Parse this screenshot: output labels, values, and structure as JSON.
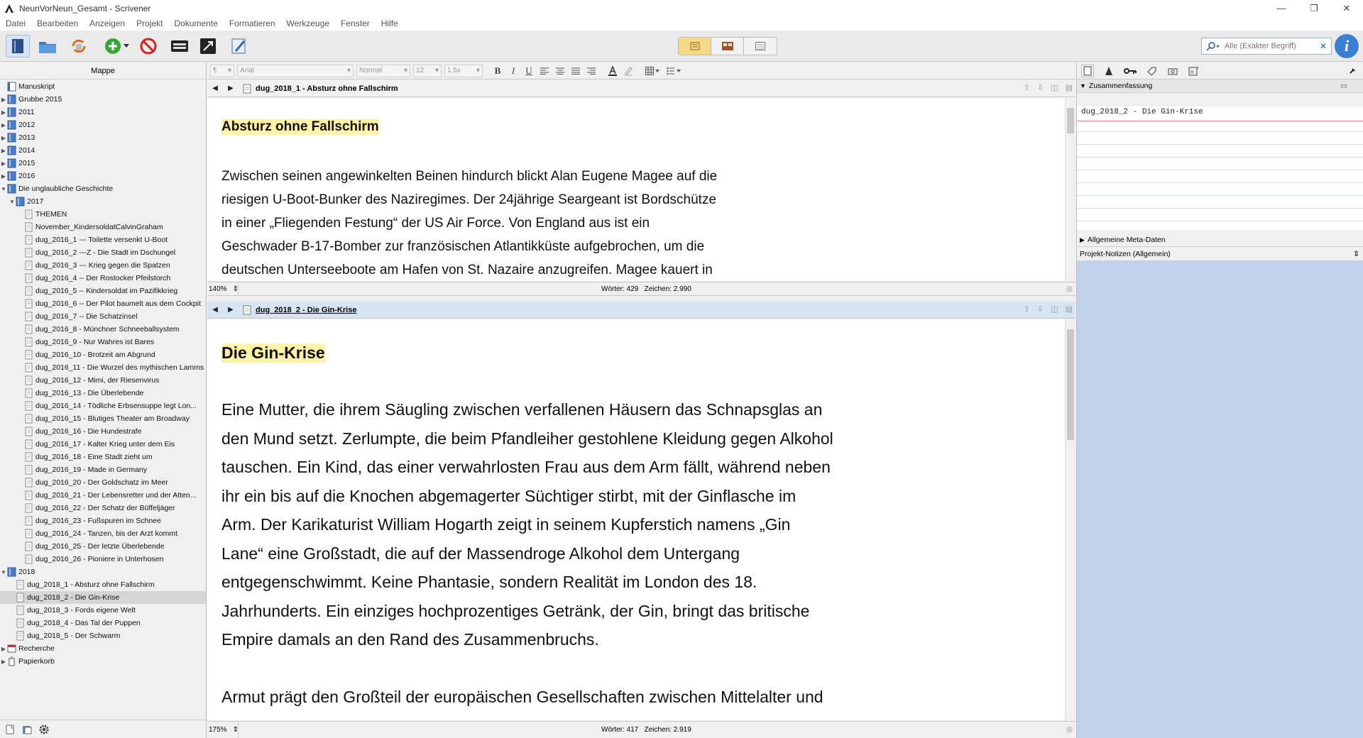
{
  "window": {
    "title": "NeunVorNeun_Gesamt - Scrivener",
    "controls": [
      "—",
      "❐",
      "✕"
    ]
  },
  "menu": [
    "Datei",
    "Bearbeiten",
    "Anzeigen",
    "Projekt",
    "Dokumente",
    "Formatieren",
    "Werkzeuge",
    "Fenster",
    "Hilfe"
  ],
  "search": {
    "placeholder": "Alle (Exakter Begriff)"
  },
  "binder": {
    "header": "Mappe",
    "items": [
      {
        "label": "Manuskript",
        "level": 0,
        "type": "book",
        "toggle": ""
      },
      {
        "label": "Grubbe 2015",
        "level": 0,
        "type": "folder",
        "toggle": "▶"
      },
      {
        "label": "2011",
        "level": 0,
        "type": "folder",
        "toggle": "▶"
      },
      {
        "label": "2012",
        "level": 0,
        "type": "folder",
        "toggle": "▶"
      },
      {
        "label": "2013",
        "level": 0,
        "type": "folder",
        "toggle": "▶"
      },
      {
        "label": "2014",
        "level": 0,
        "type": "folder",
        "toggle": "▶"
      },
      {
        "label": "2015",
        "level": 0,
        "type": "folder",
        "toggle": "▶"
      },
      {
        "label": "2016",
        "level": 0,
        "type": "folder",
        "toggle": "▶"
      },
      {
        "label": "Die unglaubliche Geschichte",
        "level": 0,
        "type": "folder",
        "toggle": "▼"
      },
      {
        "label": "2017",
        "level": 1,
        "type": "folder",
        "toggle": "▼"
      },
      {
        "label": "THEMEN",
        "level": 2,
        "type": "doc",
        "toggle": ""
      },
      {
        "label": "November_KindersoldatCalvinGraham",
        "level": 2,
        "type": "doc",
        "toggle": ""
      },
      {
        "label": "dug_2016_1 --- Toilette versenkt U-Boot",
        "level": 2,
        "type": "doc",
        "toggle": ""
      },
      {
        "label": "dug_2016_2 ---Z - Die Stadt im Dschungel",
        "level": 2,
        "type": "doc",
        "toggle": ""
      },
      {
        "label": "dug_2016_3 --- Krieg gegen die Spatzen",
        "level": 2,
        "type": "doc",
        "toggle": ""
      },
      {
        "label": "dug_2016_4 -- Der Rostocker Pfeilstorch",
        "level": 2,
        "type": "doc",
        "toggle": ""
      },
      {
        "label": "dug_2016_5 -- Kindersoldat im Pazifikkrieg",
        "level": 2,
        "type": "doc",
        "toggle": ""
      },
      {
        "label": "dug_2016_6 -- Der Pilot baumelt aus dem Cockpit",
        "level": 2,
        "type": "doc",
        "toggle": ""
      },
      {
        "label": "dug_2016_7 -- Die Schatzinsel",
        "level": 2,
        "type": "doc",
        "toggle": ""
      },
      {
        "label": "dug_2016_8 - Münchner Schneeballsystem",
        "level": 2,
        "type": "doc",
        "toggle": ""
      },
      {
        "label": "dug_2016_9 - Nur Wahres ist Bares",
        "level": 2,
        "type": "doc",
        "toggle": ""
      },
      {
        "label": "dug_2016_10 - Brotzeit am Abgrund",
        "level": 2,
        "type": "doc",
        "toggle": ""
      },
      {
        "label": "dug_2016_11 - Die Wurzel des mythischen Lamms",
        "level": 2,
        "type": "doc",
        "toggle": ""
      },
      {
        "label": "dug_2016_12 - Mimi, der Riesenvirus",
        "level": 2,
        "type": "doc",
        "toggle": ""
      },
      {
        "label": "dug_2016_13 - Die Überlebende",
        "level": 2,
        "type": "doc",
        "toggle": ""
      },
      {
        "label": "dug_2016_14 - Tödliche Erbsensuppe legt Lon...",
        "level": 2,
        "type": "doc",
        "toggle": ""
      },
      {
        "label": "dug_2016_15 - Blutiges Theater am Broadway",
        "level": 2,
        "type": "doc",
        "toggle": ""
      },
      {
        "label": "dug_2016_16 - Die Hundestrafe",
        "level": 2,
        "type": "doc",
        "toggle": ""
      },
      {
        "label": "dug_2016_17 - Kalter Krieg unter dem Eis",
        "level": 2,
        "type": "doc",
        "toggle": ""
      },
      {
        "label": "dug_2016_18 - Eine Stadt zieht um",
        "level": 2,
        "type": "doc",
        "toggle": ""
      },
      {
        "label": "dug_2016_19 - Made in Germany",
        "level": 2,
        "type": "doc",
        "toggle": ""
      },
      {
        "label": "dug_2016_20 - Der Goldschatz im Meer",
        "level": 2,
        "type": "doc",
        "toggle": ""
      },
      {
        "label": "dug_2016_21 - Der Lebensretter und der Atten...",
        "level": 2,
        "type": "doc",
        "toggle": ""
      },
      {
        "label": "dug_2016_22 - Der Schatz der Büffeljäger",
        "level": 2,
        "type": "doc",
        "toggle": ""
      },
      {
        "label": "dug_2016_23 - Fußspuren im Schnee",
        "level": 2,
        "type": "doc",
        "toggle": ""
      },
      {
        "label": "dug_2016_24 - Tanzen, bis der Arzt kommt",
        "level": 2,
        "type": "doc",
        "toggle": ""
      },
      {
        "label": "dug_2016_25 - Der letzte Überlebende",
        "level": 2,
        "type": "doc",
        "toggle": ""
      },
      {
        "label": "dug_2016_26 - Pioniere in Unterhosen",
        "level": 2,
        "type": "doc",
        "toggle": ""
      },
      {
        "label": "2018",
        "level": 0,
        "type": "folder",
        "toggle": "▼"
      },
      {
        "label": "dug_2018_1 - Absturz ohne Fallschirm",
        "level": 1,
        "type": "doc",
        "toggle": ""
      },
      {
        "label": "dug_2018_2 - Die Gin-Krise",
        "level": 1,
        "type": "doc",
        "toggle": "",
        "selected": true
      },
      {
        "label": "dug_2018_3 - Fords eigene Welt",
        "level": 1,
        "type": "doc",
        "toggle": ""
      },
      {
        "label": "dug_2018_4 - Das Tal der Puppen",
        "level": 1,
        "type": "doc",
        "toggle": ""
      },
      {
        "label": "dug_2018_5 - Der Schwarm",
        "level": 1,
        "type": "doc",
        "toggle": ""
      },
      {
        "label": "Recherche",
        "level": 0,
        "type": "research",
        "toggle": "▶"
      },
      {
        "label": "Papierkorb",
        "level": 0,
        "type": "trash",
        "toggle": "▶"
      }
    ]
  },
  "formatbar": {
    "style_a": "¶",
    "font": "Arial",
    "style": "Normal",
    "size": "12",
    "spacing": "1.5x"
  },
  "editor_top": {
    "doc_title": "dug_2018_1 - Absturz ohne Fallschirm",
    "heading": "Absturz ohne Fallschirm",
    "lines": [
      "Zwischen seinen angewinkelten Beinen hindurch blickt Alan Eugene Magee auf die",
      "riesigen U-Boot-Bunker des Naziregimes. Der 24jährige Seargeant ist Bordschütze",
      "in einer „Fliegenden Festung“ der US Air Force. Von England aus ist ein",
      "Geschwader B-17-Bomber zur französischen Atlantikküste aufgebrochen, um die",
      "deutschen Unterseeboote am Hafen von St. Nazaire anzugreifen. Magee kauert in"
    ],
    "zoom": "140%",
    "words": "Wörter: 429",
    "chars": "Zeichen: 2.990"
  },
  "editor_bottom": {
    "doc_title": "dug_2018_2 - Die Gin-Krise",
    "heading": "Die Gin-Krise",
    "lines": [
      "Eine Mutter, die ihrem Säugling zwischen verfallenen Häusern das Schnapsglas an",
      "den Mund setzt. Zerlumpte, die beim Pfandleiher gestohlene Kleidung gegen Alkohol",
      "tauschen. Ein Kind, das einer verwahrlosten Frau aus dem Arm fällt, während neben",
      "ihr ein bis auf die Knochen abgemagerter Süchtiger stirbt, mit der Ginflasche im",
      "Arm. Der Karikaturist William Hogarth zeigt in seinem Kupferstich namens „Gin",
      "Lane“ eine Großstadt, die auf der Massendroge Alkohol dem Untergang",
      "entgegenschwimmt. Keine Phantasie, sondern Realität im London des 18.",
      "Jahrhunderts. Ein einziges hochprozentiges Getränk, der Gin, bringt das britische",
      "Empire damals an den Rand des Zusammenbruchs."
    ],
    "lines2": [
      "Armut prägt den Großteil der europäischen Gesellschaften zwischen Mittelalter und"
    ],
    "zoom": "175%",
    "words": "Wörter: 417",
    "chars": "Zeichen: 2.919"
  },
  "inspector": {
    "synopsis_label": "Zusammenfassung",
    "synopsis_text": "dug_2018_2 - Die Gin-Krise",
    "meta_label": "Allgemeine Meta-Daten",
    "notes_label": "Projekt-Notizen (Allgemein)"
  },
  "colors": {
    "highlight": "#fdf2a8",
    "selected_header": "#d6e4f3",
    "notes_bg": "#c2d0ec",
    "accent": "#3b7fd4"
  }
}
